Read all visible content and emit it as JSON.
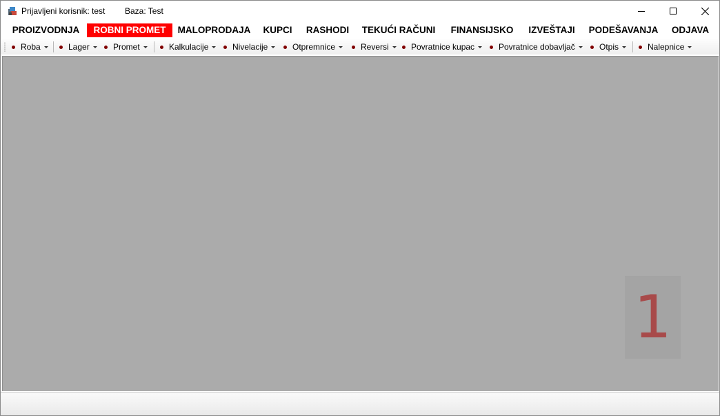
{
  "titlebar": {
    "user_label": "Prijavljeni korisnik: test",
    "db_label": "Baza: Test",
    "icons": {
      "minimize": "minimize-icon",
      "maximize": "maximize-icon",
      "close": "close-icon"
    }
  },
  "main_menu": {
    "items": [
      {
        "label": "PROIZVODNJA"
      },
      {
        "label": "ROBNI PROMET",
        "active": true
      },
      {
        "label": "MALOPRODAJA"
      },
      {
        "label": "KUPCI"
      },
      {
        "label": "RASHODI"
      },
      {
        "label": "TEKUĆI RAČUNI"
      },
      {
        "label": "FINANSIJSKO"
      },
      {
        "label": "IZVEŠTAJI"
      },
      {
        "label": "PODEŠAVANJA"
      },
      {
        "label": "ODJAVA"
      }
    ],
    "active_color": "#ff0000"
  },
  "toolbar": {
    "items": [
      {
        "label": "Roba"
      },
      {
        "label": "Lager"
      },
      {
        "label": "Promet"
      },
      {
        "label": "Kalkulacije"
      },
      {
        "label": "Nivelacije"
      },
      {
        "label": "Otpremnice"
      },
      {
        "label": "Reversi"
      },
      {
        "label": "Povratnice kupac"
      },
      {
        "label": "Povratnice dobavljač"
      },
      {
        "label": "Otpis"
      },
      {
        "label": "Nalepnice"
      }
    ],
    "bullet_color": "#800000"
  },
  "workspace": {
    "background": "#ababab",
    "badge_text": "1",
    "badge_color": "#a84a4a"
  }
}
